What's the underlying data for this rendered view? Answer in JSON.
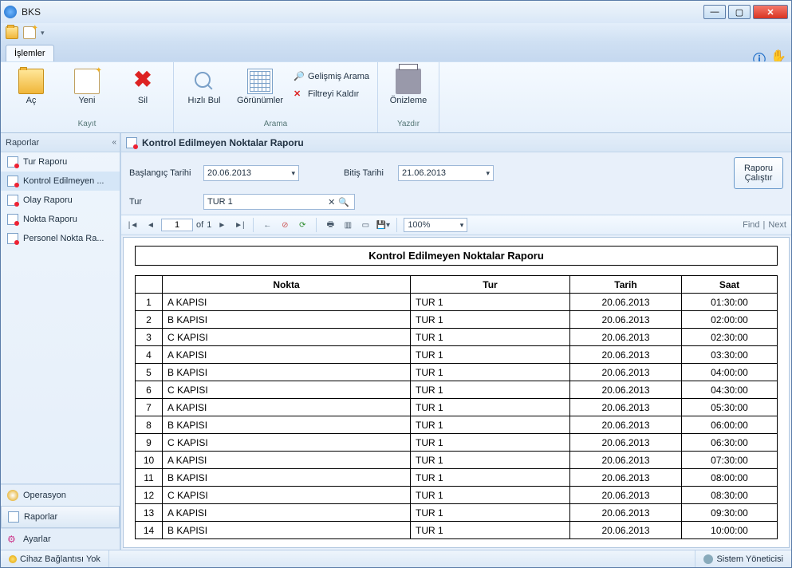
{
  "window": {
    "title": "BKS"
  },
  "ribbon": {
    "tab": "İşlemler",
    "groups": {
      "kayit": {
        "caption": "Kayıt",
        "open": "Aç",
        "new": "Yeni",
        "delete": "Sil"
      },
      "arama": {
        "caption": "Arama",
        "quickfind": "Hızlı Bul",
        "views": "Görünümler",
        "advsearch": "Gelişmiş Arama",
        "clearfilter": "Filtreyi Kaldır"
      },
      "yazdir": {
        "caption": "Yazdır",
        "preview": "Önizleme"
      }
    }
  },
  "sidebar": {
    "header": "Raporlar",
    "items": [
      {
        "label": "Tur Raporu"
      },
      {
        "label": "Kontrol Edilmeyen ..."
      },
      {
        "label": "Olay Raporu"
      },
      {
        "label": "Nokta Raporu"
      },
      {
        "label": "Personel Nokta Ra..."
      }
    ],
    "nav": {
      "operasyon": "Operasyon",
      "raporlar": "Raporlar",
      "ayarlar": "Ayarlar"
    }
  },
  "content": {
    "title": "Kontrol Edilmeyen Noktalar Raporu",
    "filters": {
      "start_label": "Başlangıç Tarihi",
      "start_value": "20.06.2013",
      "end_label": "Bitiş Tarihi",
      "end_value": "21.06.2013",
      "tur_label": "Tur",
      "tur_value": "TUR 1",
      "run": "Raporu Çalıştır"
    },
    "viewer": {
      "page_current": "1",
      "page_of": "of",
      "page_total": "1",
      "zoom": "100%",
      "find": "Find",
      "next": "Next"
    },
    "report": {
      "title": "Kontrol Edilmeyen Noktalar Raporu",
      "columns": {
        "idx": "",
        "nokta": "Nokta",
        "tur": "Tur",
        "tarih": "Tarih",
        "saat": "Saat"
      },
      "rows": [
        {
          "i": "1",
          "nokta": "A KAPISI",
          "tur": "TUR 1",
          "tarih": "20.06.2013",
          "saat": "01:30:00"
        },
        {
          "i": "2",
          "nokta": "B KAPISI",
          "tur": "TUR 1",
          "tarih": "20.06.2013",
          "saat": "02:00:00"
        },
        {
          "i": "3",
          "nokta": "C KAPISI",
          "tur": "TUR 1",
          "tarih": "20.06.2013",
          "saat": "02:30:00"
        },
        {
          "i": "4",
          "nokta": "A KAPISI",
          "tur": "TUR 1",
          "tarih": "20.06.2013",
          "saat": "03:30:00"
        },
        {
          "i": "5",
          "nokta": "B KAPISI",
          "tur": "TUR 1",
          "tarih": "20.06.2013",
          "saat": "04:00:00"
        },
        {
          "i": "6",
          "nokta": "C KAPISI",
          "tur": "TUR 1",
          "tarih": "20.06.2013",
          "saat": "04:30:00"
        },
        {
          "i": "7",
          "nokta": "A KAPISI",
          "tur": "TUR 1",
          "tarih": "20.06.2013",
          "saat": "05:30:00"
        },
        {
          "i": "8",
          "nokta": "B KAPISI",
          "tur": "TUR 1",
          "tarih": "20.06.2013",
          "saat": "06:00:00"
        },
        {
          "i": "9",
          "nokta": "C KAPISI",
          "tur": "TUR 1",
          "tarih": "20.06.2013",
          "saat": "06:30:00"
        },
        {
          "i": "10",
          "nokta": "A KAPISI",
          "tur": "TUR 1",
          "tarih": "20.06.2013",
          "saat": "07:30:00"
        },
        {
          "i": "11",
          "nokta": "B KAPISI",
          "tur": "TUR 1",
          "tarih": "20.06.2013",
          "saat": "08:00:00"
        },
        {
          "i": "12",
          "nokta": "C KAPISI",
          "tur": "TUR 1",
          "tarih": "20.06.2013",
          "saat": "08:30:00"
        },
        {
          "i": "13",
          "nokta": "A KAPISI",
          "tur": "TUR 1",
          "tarih": "20.06.2013",
          "saat": "09:30:00"
        },
        {
          "i": "14",
          "nokta": "B KAPISI",
          "tur": "TUR 1",
          "tarih": "20.06.2013",
          "saat": "10:00:00"
        }
      ]
    }
  },
  "status": {
    "device": "Cihaz Bağlantısı Yok",
    "user": "Sistem Yöneticisi"
  }
}
